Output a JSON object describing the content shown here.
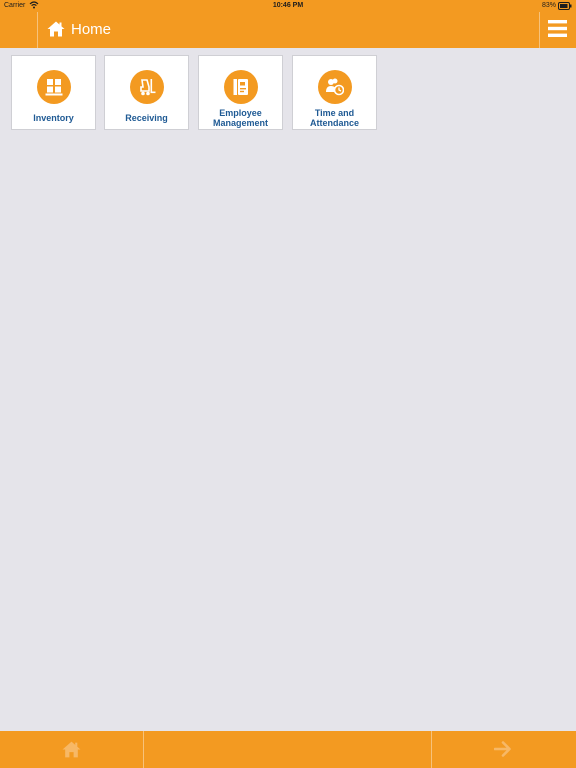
{
  "status_bar": {
    "carrier": "Carrier",
    "time": "10:46 PM",
    "battery": "83%"
  },
  "nav": {
    "title": "Home",
    "home_icon": "home-icon",
    "menu_icon": "hamburger-menu-icon"
  },
  "tiles": [
    {
      "label": "Inventory",
      "icon": "pallet-boxes-icon"
    },
    {
      "label": "Receiving",
      "icon": "forklift-icon"
    },
    {
      "label_line1": "Employee",
      "label_line2": "Management",
      "icon": "employee-badge-icon"
    },
    {
      "label_line1": "Time and",
      "label_line2": "Attendance",
      "icon": "people-clock-icon"
    }
  ],
  "bottom_bar": {
    "home_icon": "home-icon",
    "forward_icon": "arrow-right-icon"
  },
  "colors": {
    "accent": "#f39a21",
    "background": "#e5e4ea",
    "tile_text": "#1f5a94",
    "tile_border": "#cfcfd4"
  }
}
